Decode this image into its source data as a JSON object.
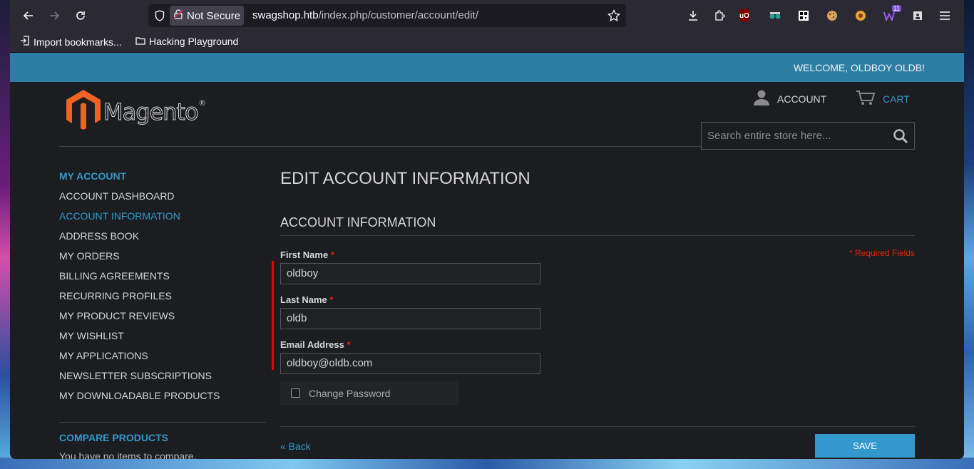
{
  "browser": {
    "url_lock_text": "Not Secure",
    "url_host": "swagshop.htb",
    "url_path": "/index.php/customer/account/edit/",
    "extension_badge": "11",
    "bookmarks": [
      {
        "label": "Import bookmarks..."
      },
      {
        "label": "Hacking Playground"
      }
    ]
  },
  "header": {
    "welcome": "WELCOME, OLDBOY OLDB!",
    "logo_text": "Magento",
    "logo_reg": "®",
    "account_label": "ACCOUNT",
    "cart_label": "CART",
    "search_placeholder": "Search entire store here..."
  },
  "sidebar": {
    "title": "MY ACCOUNT",
    "items": [
      {
        "label": "ACCOUNT DASHBOARD",
        "active": false
      },
      {
        "label": "ACCOUNT INFORMATION",
        "active": true
      },
      {
        "label": "ADDRESS BOOK",
        "active": false
      },
      {
        "label": "MY ORDERS",
        "active": false
      },
      {
        "label": "BILLING AGREEMENTS",
        "active": false
      },
      {
        "label": "RECURRING PROFILES",
        "active": false
      },
      {
        "label": "MY PRODUCT REVIEWS",
        "active": false
      },
      {
        "label": "MY WISHLIST",
        "active": false
      },
      {
        "label": "MY APPLICATIONS",
        "active": false
      },
      {
        "label": "NEWSLETTER SUBSCRIPTIONS",
        "active": false
      },
      {
        "label": "MY DOWNLOADABLE PRODUCTS",
        "active": false
      }
    ],
    "compare_title": "COMPARE PRODUCTS",
    "compare_text": "You have no items to compare."
  },
  "main": {
    "page_title": "EDIT ACCOUNT INFORMATION",
    "section_title": "ACCOUNT INFORMATION",
    "required_note": "* Required Fields",
    "required_marker": "*",
    "first_name_label": "First Name",
    "first_name_value": "oldboy",
    "last_name_label": "Last Name",
    "last_name_value": "oldb",
    "email_label": "Email Address",
    "email_value": "oldboy@oldb.com",
    "change_password_label": "Change Password",
    "back_label": "« Back",
    "save_label": "SAVE"
  },
  "colors": {
    "accent": "#3399cc",
    "welcome_bar": "#2d7ea5",
    "required": "#df280a"
  }
}
